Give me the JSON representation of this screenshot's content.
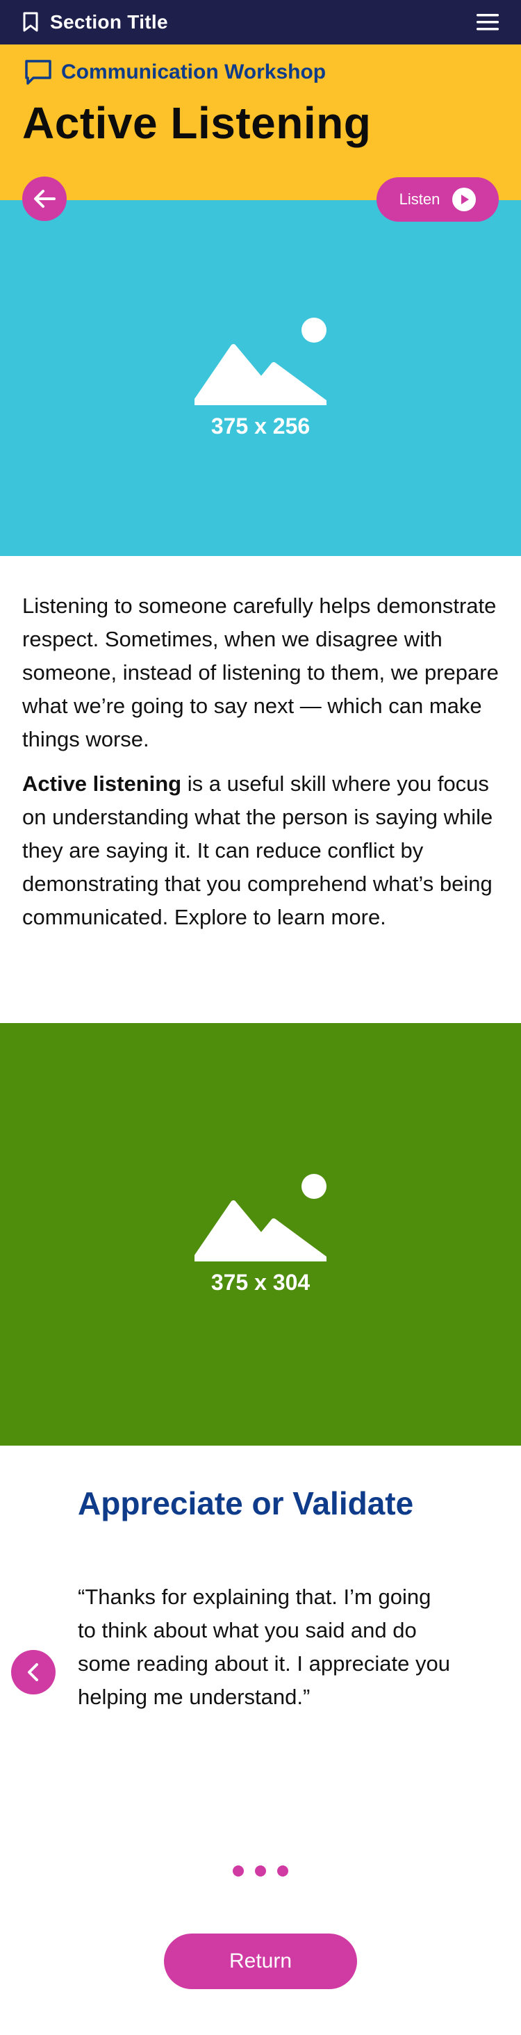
{
  "header": {
    "section_title": "Section Title",
    "icons": {
      "bookmark": "bookmark-icon",
      "menu": "hamburger-menu-icon"
    },
    "background": "#1e1f4b"
  },
  "hero": {
    "workshop_label": "Communication Workshop",
    "title": "Active Listening",
    "background": "#fdc22a",
    "listen_label": "Listen"
  },
  "image_a": {
    "placeholder": "375 x 256",
    "background": "#3cc5da"
  },
  "body": {
    "paragraph_1": "Listening to someone carefully helps demonstrate respect. Sometimes, when we disagree with someone, instead of listening to them, we prepare what we’re going to say next — which can make things worse.",
    "paragraph_2_bold": "Active listening",
    "paragraph_2_rest": " is a useful skill where you focus on understanding what the person is saying while they are saying it. It can reduce conflict by demonstrating that you comprehend what’s being communicated. Explore to learn more."
  },
  "image_b": {
    "placeholder": "375 x 304",
    "background": "#4f8d0d"
  },
  "card": {
    "title": "Appreciate or Validate",
    "quote": "“Thanks for explaining that. I’m going to think about what you said and do some reading about it. I appreciate you helping me understand.”"
  },
  "pagination": {
    "dot_count": 3
  },
  "footer": {
    "return_label": "Return"
  },
  "colors": {
    "accent": "#cf3aa3",
    "title_blue": "#0e3b8a"
  }
}
